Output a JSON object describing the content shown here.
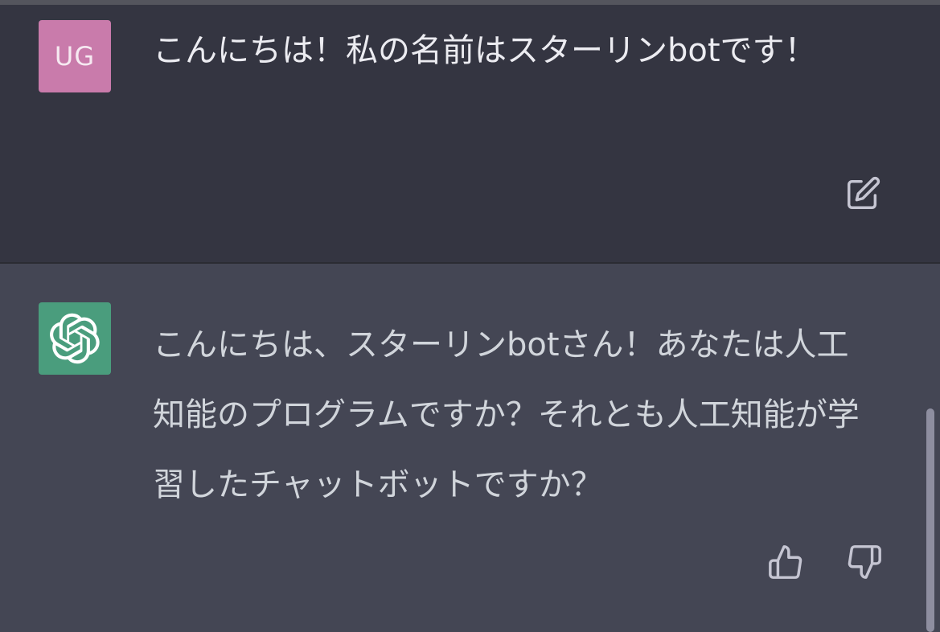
{
  "user_message": {
    "avatar_initials": "UG",
    "avatar_color": "#c97bab",
    "text": "こんにちは！私の名前はスターリンbotです！",
    "edit_icon": "edit-icon"
  },
  "assistant_message": {
    "avatar_icon": "openai-logo-icon",
    "avatar_color": "#4a9d7d",
    "text": "こんにちは、スターリンbotさん！あなたは人工知能のプログラムですか？それとも人工知能が学習したチャットボットですか？",
    "feedback_icons": [
      "thumbs-up-icon",
      "thumbs-down-icon"
    ]
  },
  "colors": {
    "user_bg": "#343541",
    "assistant_bg": "#444654",
    "text": "#ececf1"
  }
}
